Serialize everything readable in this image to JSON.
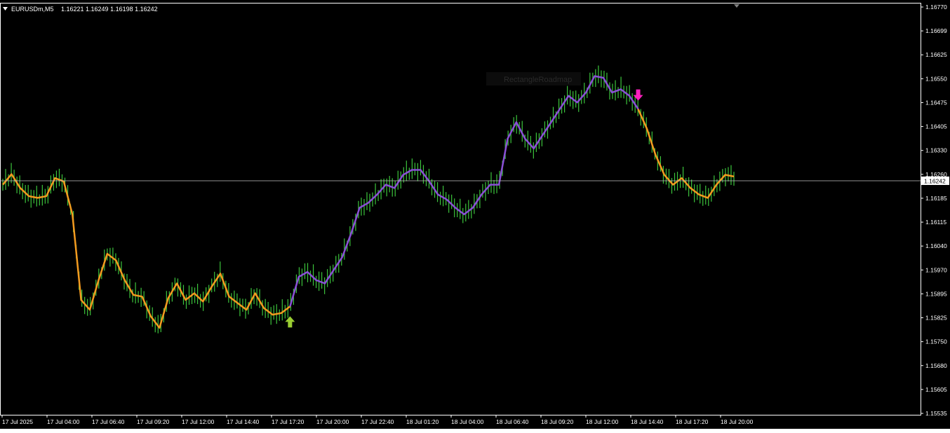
{
  "window": {
    "symbol_label": "EURUSDm,M5",
    "ohlc_readout": "1.16221 1.16249 1.16198 1.16242"
  },
  "colors": {
    "background": "#000000",
    "candles": "#3cc43c",
    "ma_bearish": "#f29a1f",
    "ma_bullish": "#8a4fd6",
    "buy_arrow": "#9acd32",
    "sell_arrow": "#ff1fbf",
    "price_line": "#c0c0c0",
    "axis": "#ffffff"
  },
  "watermark": "RectangleRoadmap",
  "chart_data": {
    "type": "line",
    "title": "",
    "xlabel": "",
    "ylabel": "",
    "ylim": [
      1.15535,
      1.1677
    ],
    "grid": false,
    "y_ticks": [
      "1.16770",
      "1.16699",
      "1.16625",
      "1.16550",
      "1.16475",
      "1.16405",
      "1.16330",
      "1.16260",
      "1.16185",
      "1.16115",
      "1.16040",
      "1.15970",
      "1.15895",
      "1.15825",
      "1.15750",
      "1.15680",
      "1.15605",
      "1.15535"
    ],
    "x_ticks": [
      "17 Jul 2025",
      "17 Jul 04:00",
      "17 Jul 06:40",
      "17 Jul 09:20",
      "17 Jul 12:00",
      "17 Jul 14:40",
      "17 Jul 17:20",
      "17 Jul 20:00",
      "17 Jul 22:40",
      "18 Jul 01:20",
      "18 Jul 04:00",
      "18 Jul 06:40",
      "18 Jul 09:20",
      "18 Jul 12:00",
      "18 Jul 14:40",
      "18 Jul 17:20",
      "18 Jul 20:00"
    ],
    "current_price": "1.16242",
    "series": [
      {
        "values": [
          1.1623,
          1.16262,
          1.1622,
          1.16195,
          1.1619,
          1.16195,
          1.1625,
          1.1624,
          1.1614,
          1.1588,
          1.1585,
          1.1594,
          1.1602,
          1.16,
          1.1594,
          1.15895,
          1.1589,
          1.1583,
          1.15795,
          1.15885,
          1.1593,
          1.1588,
          1.159,
          1.15875,
          1.1592,
          1.1596,
          1.1589,
          1.1587,
          1.1585,
          1.159,
          1.15855,
          1.15835,
          1.1584,
          1.1586,
          1.1595,
          1.15965,
          1.1594,
          1.1593,
          1.1597,
          1.1601,
          1.1608,
          1.1616,
          1.16175,
          1.162,
          1.1623,
          1.1622,
          1.1626,
          1.16275,
          1.16275,
          1.1624,
          1.162,
          1.16185,
          1.1616,
          1.1614,
          1.1616,
          1.162,
          1.1623,
          1.1623,
          1.1637,
          1.1642,
          1.1637,
          1.1634,
          1.1638,
          1.1642,
          1.1646,
          1.165,
          1.1648,
          1.1651,
          1.1656,
          1.16555,
          1.1651,
          1.1652,
          1.165,
          1.1646,
          1.164,
          1.1632,
          1.1626,
          1.1623,
          1.1625,
          1.1622,
          1.162,
          1.1619,
          1.1623,
          1.1626,
          1.16255
        ]
      }
    ],
    "signals": [
      {
        "type": "buy",
        "index": 33
      },
      {
        "type": "sell",
        "index": 73
      }
    ]
  }
}
